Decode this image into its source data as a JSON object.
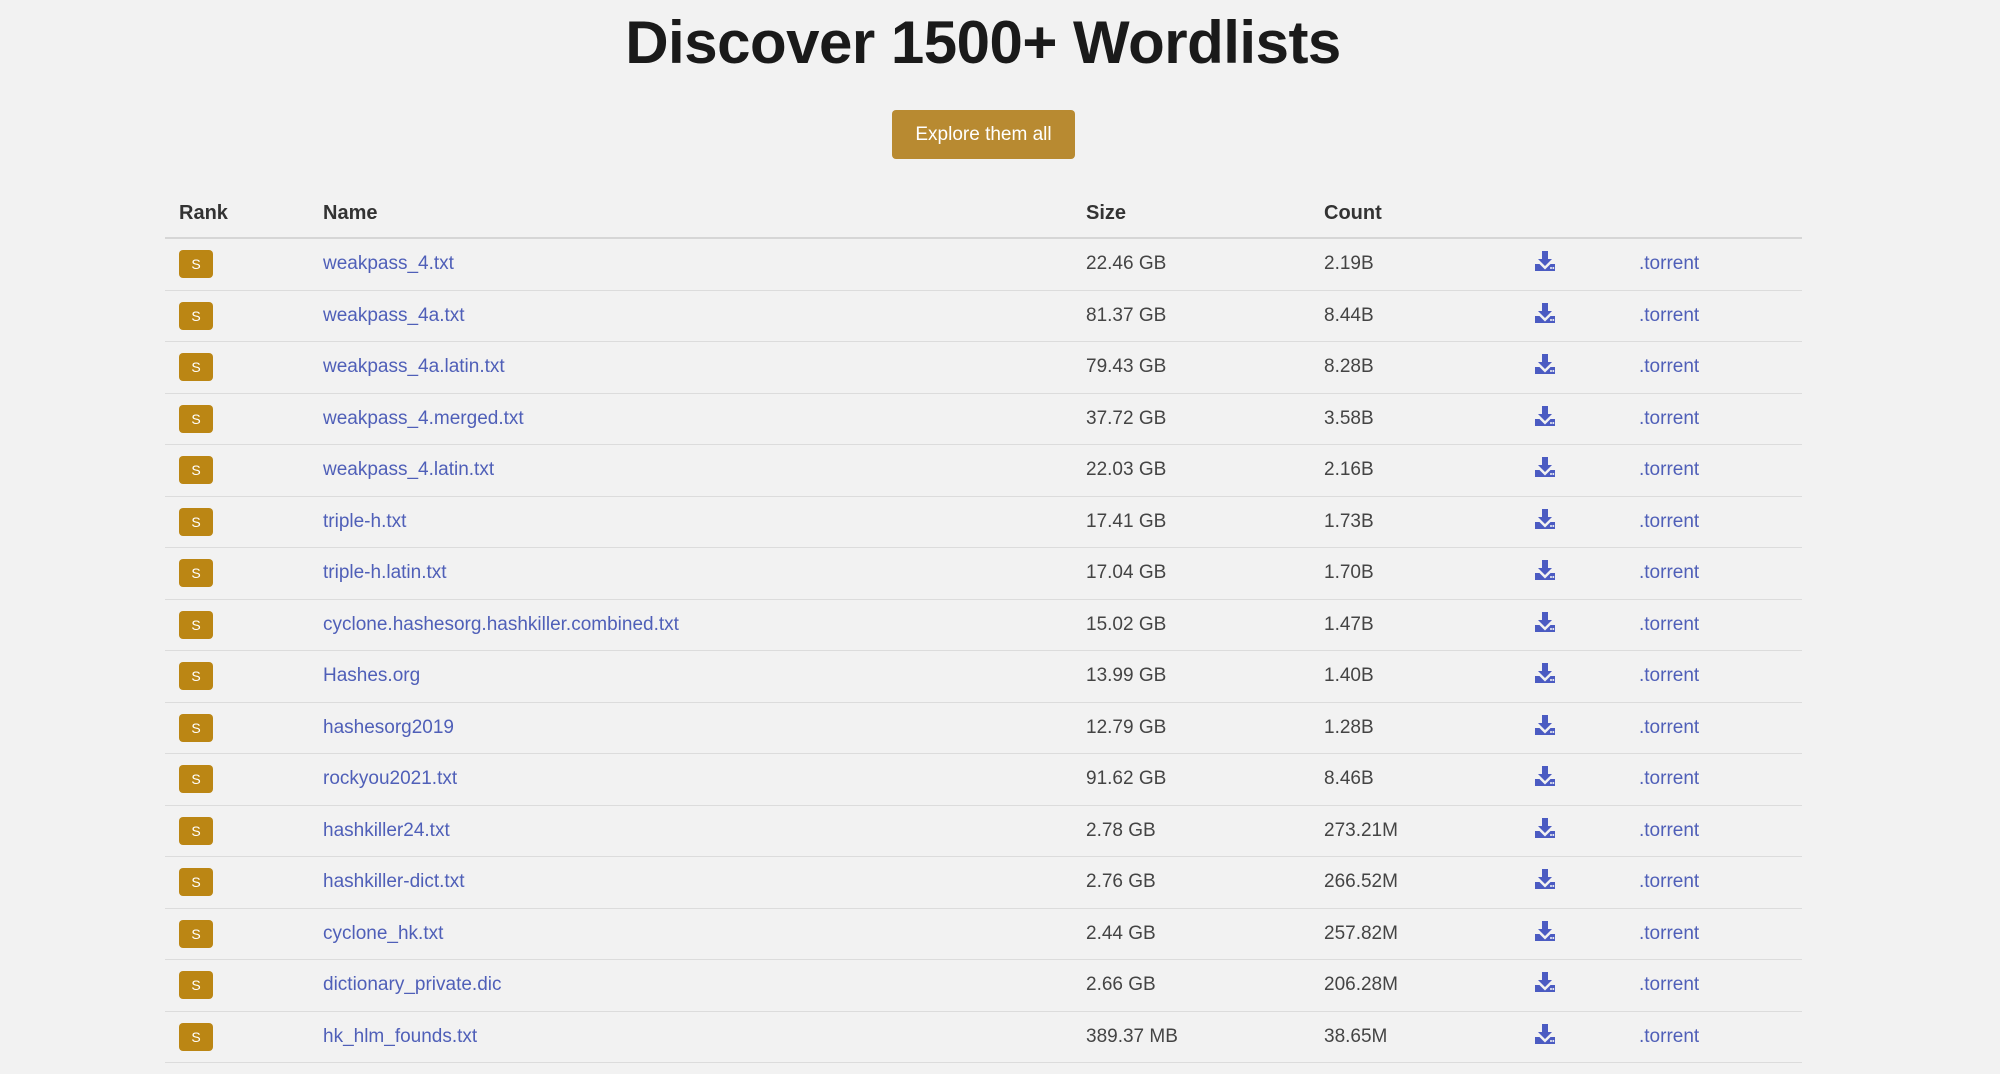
{
  "header": {
    "title": "Discover 1500+ Wordlists",
    "explore_button": "Explore them all"
  },
  "table": {
    "columns": [
      "Rank",
      "Name",
      "Size",
      "Count"
    ],
    "rows": [
      {
        "rank": "S",
        "name": "weakpass_4.txt",
        "size": "22.46 GB",
        "count": "2.19B",
        "torrent": ".torrent"
      },
      {
        "rank": "S",
        "name": "weakpass_4a.txt",
        "size": "81.37 GB",
        "count": "8.44B",
        "torrent": ".torrent"
      },
      {
        "rank": "S",
        "name": "weakpass_4a.latin.txt",
        "size": "79.43 GB",
        "count": "8.28B",
        "torrent": ".torrent"
      },
      {
        "rank": "S",
        "name": "weakpass_4.merged.txt",
        "size": "37.72 GB",
        "count": "3.58B",
        "torrent": ".torrent"
      },
      {
        "rank": "S",
        "name": "weakpass_4.latin.txt",
        "size": "22.03 GB",
        "count": "2.16B",
        "torrent": ".torrent"
      },
      {
        "rank": "S",
        "name": "triple-h.txt",
        "size": "17.41 GB",
        "count": "1.73B",
        "torrent": ".torrent"
      },
      {
        "rank": "S",
        "name": "triple-h.latin.txt",
        "size": "17.04 GB",
        "count": "1.70B",
        "torrent": ".torrent"
      },
      {
        "rank": "S",
        "name": "cyclone.hashesorg.hashkiller.combined.txt",
        "size": "15.02 GB",
        "count": "1.47B",
        "torrent": ".torrent"
      },
      {
        "rank": "S",
        "name": "Hashes.org",
        "size": "13.99 GB",
        "count": "1.40B",
        "torrent": ".torrent"
      },
      {
        "rank": "S",
        "name": "hashesorg2019",
        "size": "12.79 GB",
        "count": "1.28B",
        "torrent": ".torrent"
      },
      {
        "rank": "S",
        "name": "rockyou2021.txt",
        "size": "91.62 GB",
        "count": "8.46B",
        "torrent": ".torrent"
      },
      {
        "rank": "S",
        "name": "hashkiller24.txt",
        "size": "2.78 GB",
        "count": "273.21M",
        "torrent": ".torrent"
      },
      {
        "rank": "S",
        "name": "hashkiller-dict.txt",
        "size": "2.76 GB",
        "count": "266.52M",
        "torrent": ".torrent"
      },
      {
        "rank": "S",
        "name": "cyclone_hk.txt",
        "size": "2.44 GB",
        "count": "257.82M",
        "torrent": ".torrent"
      },
      {
        "rank": "S",
        "name": "dictionary_private.dic",
        "size": "2.66 GB",
        "count": "206.28M",
        "torrent": ".torrent"
      },
      {
        "rank": "S",
        "name": "hk_hlm_founds.txt",
        "size": "389.37 MB",
        "count": "38.65M",
        "torrent": ".torrent"
      }
    ]
  },
  "icons": {
    "download": "download-icon"
  },
  "colors": {
    "accent_button": "#b88a31",
    "rank_badge": "#bb8614",
    "link": "#4f5fb8",
    "background": "#f2f2f2"
  }
}
